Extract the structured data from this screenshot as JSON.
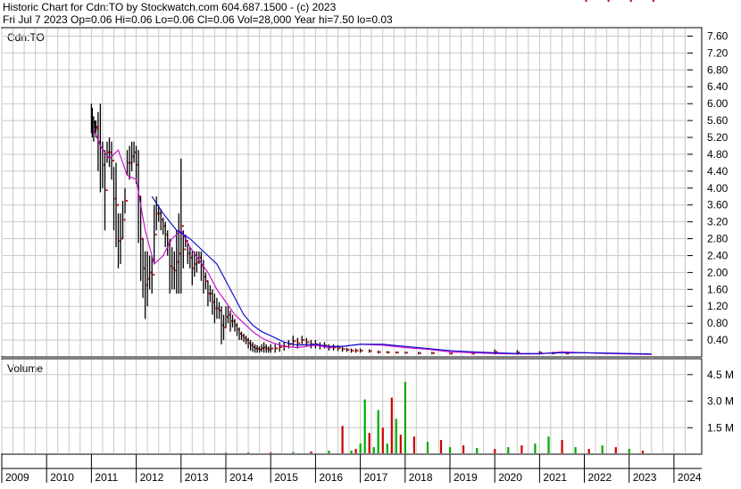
{
  "header": {
    "line1": "Historic Chart for Cdn:TO by Stockwatch.com 604.687.1500 - (c) 2023",
    "line2": "Fri Jul  7 2023  Op=0.06  Hi=0.06  Lo=0.06  Cl=0.06  Vol=28,000  Year hi=7.50  lo=0.03"
  },
  "chart_data": [
    {
      "type": "line",
      "title": "Cdn:TO",
      "ylim": [
        0,
        7.8
      ],
      "xlim": [
        2009.0,
        2024.3
      ],
      "yticks": [
        "7.60",
        "7.20",
        "6.80",
        "6.40",
        "6.00",
        "5.60",
        "5.20",
        "4.80",
        "4.40",
        "4.00",
        "3.60",
        "3.20",
        "2.80",
        "2.40",
        "2.00",
        "1.60",
        "1.20",
        "0.80",
        "0.40"
      ],
      "ytick_values": [
        7.6,
        7.2,
        6.8,
        6.4,
        6.0,
        5.6,
        5.2,
        4.8,
        4.4,
        4.0,
        3.6,
        3.2,
        2.8,
        2.4,
        2.0,
        1.6,
        1.2,
        0.8,
        0.4
      ],
      "grid": true,
      "colors": {
        "price": "#000000",
        "close_dot": "#cc0000",
        "ma_short": "#cc00cc",
        "ma_long": "#0000cc"
      },
      "series": [
        {
          "key": "price",
          "x": [
            2011.0,
            2011.02,
            2011.05,
            2011.08,
            2011.1,
            2011.15,
            2011.2,
            2011.25,
            2011.3,
            2011.35,
            2011.4,
            2011.45,
            2011.5,
            2011.55,
            2011.6,
            2011.65,
            2011.7,
            2011.75,
            2011.8,
            2011.85,
            2011.9,
            2011.95,
            2012.0,
            2012.05,
            2012.1,
            2012.15,
            2012.2,
            2012.25,
            2012.3,
            2012.35,
            2012.4,
            2012.45,
            2012.5,
            2012.55,
            2012.6,
            2012.65,
            2012.7,
            2012.75,
            2012.8,
            2012.85,
            2012.9,
            2012.95,
            2013.0,
            2013.05,
            2013.1,
            2013.15,
            2013.2,
            2013.25,
            2013.3,
            2013.35,
            2013.4,
            2013.45,
            2013.5,
            2013.55,
            2013.6,
            2013.65,
            2013.7,
            2013.75,
            2013.8,
            2013.85,
            2013.9,
            2013.95,
            2014.0,
            2014.05,
            2014.1,
            2014.15,
            2014.2,
            2014.25,
            2014.3,
            2014.35,
            2014.4,
            2014.45,
            2014.5,
            2014.55,
            2014.6,
            2014.65,
            2014.7,
            2014.75,
            2014.8,
            2014.85,
            2014.9,
            2014.95,
            2015.0,
            2015.1,
            2015.2,
            2015.3,
            2015.4,
            2015.5,
            2015.6,
            2015.7,
            2015.8,
            2015.9,
            2016.0,
            2016.1,
            2016.2,
            2016.3,
            2016.4,
            2016.5,
            2016.6,
            2016.7,
            2016.8,
            2016.9,
            2017.0,
            2017.2,
            2017.4,
            2017.6,
            2017.8,
            2018.0,
            2018.3,
            2018.6,
            2019.0,
            2019.5,
            2020.0,
            2020.5,
            2021.0,
            2021.3,
            2021.6,
            2022.0,
            2022.5,
            2023.0,
            2023.5
          ],
          "low": [
            5.3,
            5.2,
            5.1,
            5.3,
            5.2,
            4.4,
            3.9,
            4.0,
            3.0,
            4.6,
            4.5,
            4.2,
            3.0,
            2.6,
            2.1,
            2.2,
            2.8,
            3.4,
            4.3,
            4.2,
            4.4,
            4.6,
            4.1,
            2.7,
            1.8,
            1.4,
            0.9,
            1.2,
            1.6,
            1.5,
            2.2,
            3.0,
            3.2,
            3.0,
            2.9,
            2.6,
            2.4,
            1.5,
            1.6,
            1.6,
            1.5,
            1.5,
            1.5,
            2.1,
            2.6,
            2.2,
            2.1,
            1.7,
            1.9,
            2.0,
            2.2,
            1.8,
            1.5,
            1.6,
            1.2,
            1.3,
            1.0,
            0.8,
            0.9,
            0.9,
            0.3,
            0.4,
            0.7,
            0.8,
            0.6,
            0.7,
            0.6,
            0.5,
            0.4,
            0.4,
            0.35,
            0.3,
            0.2,
            0.15,
            0.12,
            0.1,
            0.1,
            0.1,
            0.12,
            0.1,
            0.1,
            0.1,
            0.1,
            0.1,
            0.12,
            0.15,
            0.2,
            0.25,
            0.2,
            0.3,
            0.25,
            0.2,
            0.2,
            0.18,
            0.2,
            0.15,
            0.15,
            0.14,
            0.12,
            0.12,
            0.1,
            0.1,
            0.1,
            0.1,
            0.08,
            0.08,
            0.08,
            0.08,
            0.06,
            0.06,
            0.06,
            0.06,
            0.06,
            0.06,
            0.06,
            0.06,
            0.06
          ],
          "high": [
            6.0,
            5.9,
            5.7,
            5.6,
            5.6,
            5.8,
            6.0,
            5.1,
            4.9,
            5.1,
            5.2,
            5.1,
            4.5,
            4.6,
            3.4,
            3.4,
            3.7,
            4.0,
            4.9,
            5.0,
            5.1,
            5.1,
            5.0,
            4.9,
            3.8,
            2.8,
            2.5,
            2.5,
            2.4,
            2.4,
            3.6,
            3.8,
            3.6,
            3.5,
            3.3,
            3.2,
            3.0,
            2.8,
            2.6,
            2.5,
            3.0,
            3.4,
            4.7,
            3.0,
            2.9,
            2.7,
            2.6,
            2.5,
            2.5,
            2.5,
            2.5,
            2.5,
            2.3,
            2.0,
            1.8,
            1.7,
            1.6,
            1.5,
            1.4,
            1.3,
            1.2,
            1.0,
            1.2,
            1.2,
            1.1,
            1.0,
            0.9,
            0.8,
            0.7,
            0.6,
            0.55,
            0.5,
            0.45,
            0.4,
            0.35,
            0.3,
            0.28,
            0.25,
            0.3,
            0.35,
            0.3,
            0.25,
            0.3,
            0.3,
            0.35,
            0.35,
            0.4,
            0.5,
            0.45,
            0.5,
            0.45,
            0.4,
            0.4,
            0.35,
            0.35,
            0.3,
            0.3,
            0.28,
            0.25,
            0.22,
            0.2,
            0.2,
            0.2,
            0.18,
            0.15,
            0.14,
            0.13,
            0.12,
            0.12,
            0.12,
            0.1,
            0.1,
            0.18,
            0.16,
            0.14,
            0.12,
            0.1
          ]
        },
        {
          "key": "ma_short",
          "x": [
            2011.05,
            2011.2,
            2011.4,
            2011.6,
            2011.8,
            2012.0,
            2012.2,
            2012.4,
            2012.6,
            2012.8,
            2013.0,
            2013.2,
            2013.4,
            2013.6,
            2013.8,
            2014.0,
            2014.2,
            2014.4,
            2014.6,
            2014.8,
            2015.0,
            2015.3,
            2015.6,
            2016.0,
            2016.3,
            2016.6,
            2017.0,
            2017.5,
            2018.0,
            2018.5,
            2019.0,
            2019.5,
            2020.0,
            2020.5,
            2021.0,
            2021.5,
            2022.0,
            2022.5,
            2023.0,
            2023.5
          ],
          "y": [
            5.4,
            5.0,
            4.7,
            4.9,
            4.3,
            4.2,
            3.0,
            2.2,
            2.4,
            2.8,
            3.0,
            2.6,
            2.3,
            2.0,
            1.6,
            1.3,
            1.0,
            0.8,
            0.6,
            0.45,
            0.35,
            0.25,
            0.22,
            0.28,
            0.22,
            0.25,
            0.3,
            0.28,
            0.22,
            0.18,
            0.12,
            0.1,
            0.08,
            0.07,
            0.07,
            0.12,
            0.1,
            0.08,
            0.07,
            0.06
          ]
        },
        {
          "key": "ma_long",
          "x": [
            2012.35,
            2012.6,
            2012.9,
            2013.2,
            2013.4,
            2013.6,
            2013.8,
            2014.0,
            2014.2,
            2014.4,
            2014.6,
            2014.8,
            2015.0,
            2015.3,
            2015.6,
            2016.0,
            2016.3,
            2016.6,
            2017.0,
            2017.5,
            2018.0,
            2018.5,
            2019.0,
            2019.5,
            2020.0,
            2020.5,
            2021.0,
            2021.5,
            2022.0,
            2022.5,
            2023.0,
            2023.5
          ],
          "y": [
            3.8,
            3.4,
            3.0,
            2.8,
            2.6,
            2.4,
            2.2,
            1.8,
            1.4,
            1.0,
            0.75,
            0.6,
            0.5,
            0.35,
            0.28,
            0.3,
            0.25,
            0.25,
            0.3,
            0.3,
            0.25,
            0.2,
            0.15,
            0.12,
            0.1,
            0.08,
            0.08,
            0.1,
            0.1,
            0.09,
            0.08,
            0.07
          ]
        }
      ]
    },
    {
      "type": "bar",
      "title": "Volume",
      "ylim": [
        0,
        5.4
      ],
      "yticks": [
        "4.5 M",
        "3.0 M",
        "1.5 M"
      ],
      "ytick_values": [
        4.5,
        3.0,
        1.5
      ],
      "x_years": [
        "2009",
        "2010",
        "2011",
        "2012",
        "2013",
        "2014",
        "2015",
        "2016",
        "2017",
        "2018",
        "2019",
        "2020",
        "2021",
        "2022",
        "2023",
        "2024"
      ],
      "colors": {
        "up": "#00aa00",
        "down": "#cc0000"
      },
      "x": [
        2011.0,
        2011.5,
        2012.0,
        2012.5,
        2013.0,
        2013.5,
        2014.0,
        2014.5,
        2015.0,
        2015.5,
        2015.9,
        2016.3,
        2016.6,
        2016.8,
        2016.9,
        2017.0,
        2017.1,
        2017.2,
        2017.3,
        2017.4,
        2017.5,
        2017.6,
        2017.7,
        2017.8,
        2017.9,
        2018.0,
        2018.2,
        2018.5,
        2018.8,
        2019.0,
        2019.3,
        2019.6,
        2020.0,
        2020.3,
        2020.6,
        2020.9,
        2021.2,
        2021.5,
        2021.8,
        2022.1,
        2022.4,
        2022.7,
        2023.0,
        2023.3
      ],
      "values": [
        0.05,
        0.05,
        0.04,
        0.05,
        0.05,
        0.06,
        0.08,
        0.1,
        0.1,
        0.12,
        0.15,
        0.2,
        1.6,
        0.2,
        0.3,
        0.6,
        3.1,
        1.2,
        0.4,
        2.5,
        1.5,
        0.6,
        3.2,
        2.0,
        1.1,
        4.1,
        1.0,
        0.7,
        0.8,
        0.4,
        0.5,
        0.35,
        0.3,
        0.4,
        0.5,
        0.6,
        1.0,
        0.8,
        0.4,
        0.3,
        0.5,
        0.4,
        0.3,
        0.2
      ],
      "up": [
        false,
        true,
        false,
        true,
        false,
        true,
        false,
        true,
        false,
        true,
        false,
        true,
        false,
        true,
        false,
        true,
        true,
        false,
        true,
        true,
        false,
        true,
        false,
        true,
        false,
        true,
        false,
        true,
        false,
        true,
        false,
        true,
        false,
        true,
        false,
        true,
        true,
        false,
        true,
        false,
        true,
        false,
        true,
        false
      ]
    }
  ]
}
